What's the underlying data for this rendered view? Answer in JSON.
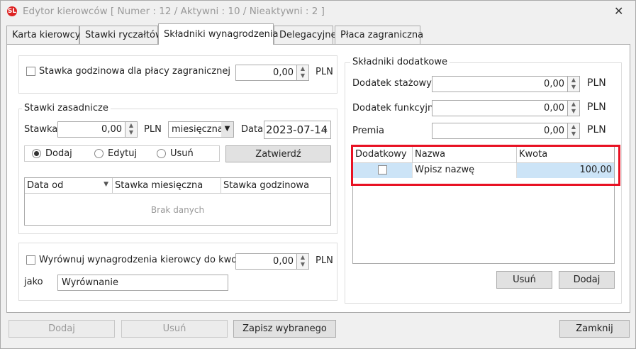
{
  "window": {
    "title": "Edytor kierowców [ Numer : 12 / Aktywni : 10 / Nieaktywni : 2 ]",
    "close": "✕"
  },
  "tabs": [
    "Karta kierowcy",
    "Stawki ryczałtów",
    "Składniki wynagrodzenia",
    "Delegacyjne",
    "Płaca zagraniczna"
  ],
  "foreign_hourly": {
    "label": "Stawka godzinowa dla płacy zagranicznej",
    "value": "0,00",
    "unit": "PLN",
    "checked": false
  },
  "base_rates": {
    "group": "Stawki zasadnicze",
    "stawka_label": "Stawka",
    "value": "0,00",
    "unit": "PLN",
    "period": "miesięczna",
    "date_label": "Data",
    "date": "2023-07-14",
    "radios": [
      {
        "label": "Dodaj",
        "selected": true
      },
      {
        "label": "Edytuj",
        "selected": false
      },
      {
        "label": "Usuń",
        "selected": false
      }
    ],
    "confirm": "Zatwierdź",
    "columns": [
      "Data od",
      "Stawka miesięczna",
      "Stawka godzinowa"
    ],
    "empty": "Brak danych"
  },
  "equalize": {
    "label": "Wyrównuj wynagrodzenia kierowcy do kwoty",
    "value": "0,00",
    "unit": "PLN",
    "checked": false,
    "jako_label": "jako",
    "jako_value": "Wyrównanie"
  },
  "extras": {
    "group": "Składniki dodatkowe",
    "rows": [
      {
        "label": "Dodatek stażowy",
        "value": "0,00",
        "unit": "PLN"
      },
      {
        "label": "Dodatek funkcyjny",
        "value": "0,00",
        "unit": "PLN"
      },
      {
        "label": "Premia",
        "value": "0,00",
        "unit": "PLN"
      }
    ],
    "columns": [
      "Dodatkowy",
      "Nazwa",
      "Kwota"
    ],
    "items": [
      {
        "dodatkowy": false,
        "nazwa": "Wpisz nazwę",
        "kwota": "100,00"
      }
    ],
    "remove": "Usuń",
    "add": "Dodaj",
    "highlight_color": "#e81123"
  },
  "footer": {
    "add": "Dodaj",
    "remove": "Usuń",
    "save": "Zapisz wybranego",
    "close": "Zamknij"
  }
}
